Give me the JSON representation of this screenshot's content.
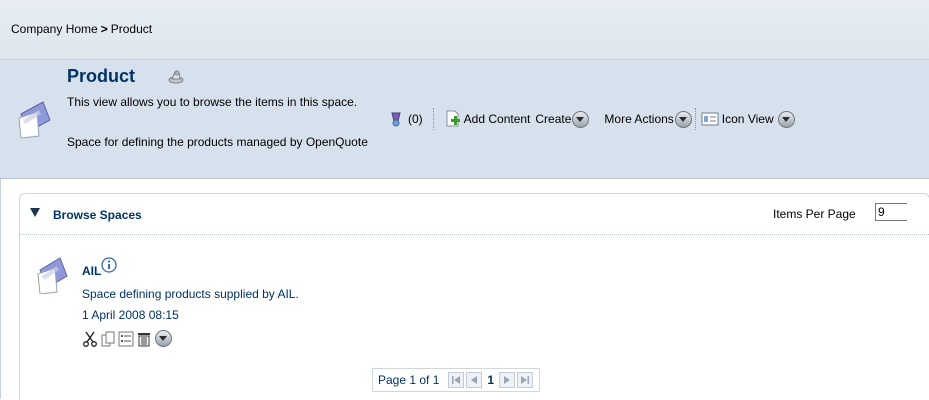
{
  "breadcrumb": {
    "items": [
      "Company Home",
      "Product"
    ],
    "separator": ">"
  },
  "header": {
    "title": "Product",
    "description": "This view allows you to browse the items in this space.",
    "space_description": "Space for defining the products managed by OpenQuote"
  },
  "actions": {
    "rules_count": "(0)",
    "add_content": "Add Content",
    "create": "Create",
    "more_actions": "More Actions",
    "view": "Icon View"
  },
  "browse": {
    "title": "Browse Spaces",
    "items_per_page_label": "Items Per Page",
    "items_per_page_value": "9",
    "items": [
      {
        "name": "AIL",
        "description": "Space defining products supplied by AIL.",
        "date": "1 April 2008 08:15"
      }
    ],
    "pagination": {
      "label": "Page 1 of 1",
      "current": "1"
    }
  },
  "icons": [
    "space-icon",
    "rss-icon",
    "rules-icon",
    "add-content-icon",
    "icon-view-icon",
    "info-icon",
    "cut-icon",
    "copy-icon",
    "details-icon",
    "delete-icon",
    "more-icon",
    "first-page-icon",
    "prev-page-icon",
    "next-page-icon",
    "last-page-icon"
  ],
  "colors": {
    "link": "#003366",
    "header_bg": "#d7e1ed",
    "breadcrumb_bg": "#e4eaf2"
  }
}
